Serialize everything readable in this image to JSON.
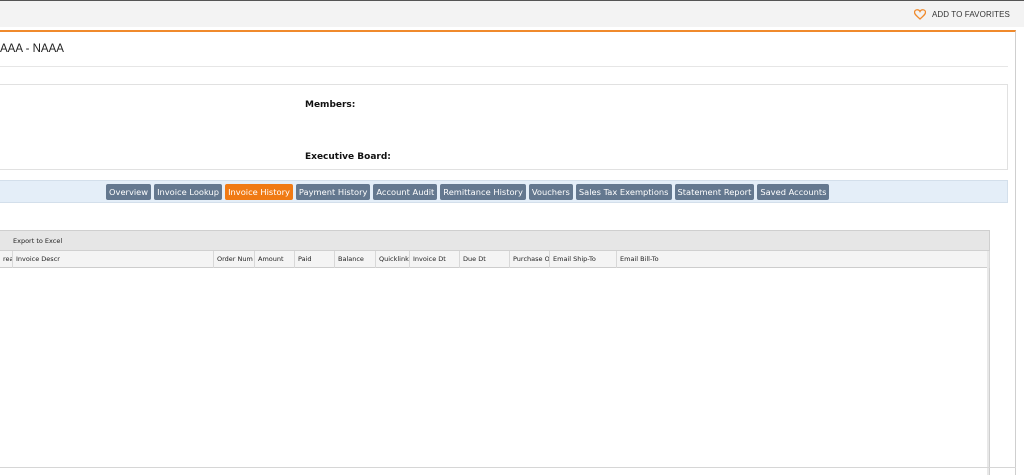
{
  "topbar": {
    "favorites_label": "ADD TO FAVORITES",
    "favorites_icon": "heart-icon",
    "accent_color": "#f08a2c"
  },
  "page": {
    "title": "AAA - NAAA"
  },
  "info": {
    "members_label": "Members:",
    "executive_board_label": "Executive Board:"
  },
  "tabs": [
    {
      "label": "Overview",
      "active": false
    },
    {
      "label": "Invoice Lookup",
      "active": false
    },
    {
      "label": "Invoice History",
      "active": true
    },
    {
      "label": "Payment History",
      "active": false
    },
    {
      "label": "Account Audit",
      "active": false
    },
    {
      "label": "Remittance History",
      "active": false
    },
    {
      "label": "Vouchers",
      "active": false
    },
    {
      "label": "Sales Tax Exemptions",
      "active": false
    },
    {
      "label": "Statement Report",
      "active": false
    },
    {
      "label": "Saved Accounts",
      "active": false
    }
  ],
  "grid": {
    "export_label": "Export to Excel",
    "columns": [
      "rea",
      "Invoice Descr",
      "Order Num",
      "Amount",
      "Paid",
      "Balance",
      "Quicklink",
      "Invoice Dt",
      "Due Dt",
      "Purchase O",
      "Email Ship-To",
      "Email Bill-To"
    ],
    "rows": []
  },
  "colors": {
    "tab_default": "#64788f",
    "tab_active": "#f07a14",
    "tabbar_bg": "#e4eef8"
  }
}
